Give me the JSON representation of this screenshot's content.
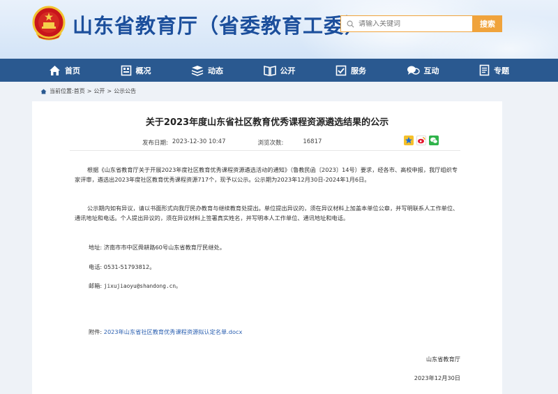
{
  "header": {
    "site_title": "山东省教育厅（省委教育工委）",
    "search_placeholder": "请输入关键词",
    "search_button": "搜索"
  },
  "nav": {
    "items": [
      {
        "label": "首页",
        "icon": "home-icon"
      },
      {
        "label": "概况",
        "icon": "overview-icon"
      },
      {
        "label": "动态",
        "icon": "news-icon"
      },
      {
        "label": "公开",
        "icon": "book-icon"
      },
      {
        "label": "服务",
        "icon": "service-icon"
      },
      {
        "label": "互动",
        "icon": "chat-icon"
      },
      {
        "label": "专题",
        "icon": "topic-icon"
      }
    ]
  },
  "breadcrumb": {
    "prefix": "当前位置:",
    "items": [
      "首页",
      "公开",
      "公示公告"
    ],
    "separator": ">"
  },
  "article": {
    "title": "关于2023年度山东省社区教育优秀课程资源遴选结果的公示",
    "publish_label": "发布日期:",
    "publish_date": "2023-12-30 10:47",
    "views_label": "浏览次数:",
    "views": "16817",
    "share_icons": [
      "qzone-icon",
      "weibo-icon",
      "wechat-icon"
    ],
    "paragraph1": "根据《山东省教育厅关于开展2023年度社区教育优秀课程资源遴选活动的通知》（鲁教民函〔2023〕14号）要求，经各市、高校申报，我厅组织专家评审，遴选出2023年度社区教育优秀课程资源717个，现予以公示。公示期为2023年12月30日-2024年1月6日。",
    "paragraph2": "公示期内如有异议，请以书面形式向我厅民办教育与继续教育处提出。单位提出异议的，须在异议材料上加盖本单位公章，并写明联系人工作单位、通讯地址和电话。个人提出异议的，须在异议材料上签署真实姓名，并写明本人工作单位、通讯地址和电话。",
    "address_label": "地址:",
    "address": "济南市市中区舜耕路60号山东省教育厅民继处。",
    "tel_label": "电话:",
    "tel": "0531-51793812。",
    "email_label": "邮箱:",
    "email": "jixujiaoyu@shandong.cn。",
    "attachment_label": "附件:",
    "attachment": "2023年山东省社区教育优秀课程资源拟认定名单.docx",
    "signature": "山东省教育厅",
    "sign_date": "2023年12月30日"
  },
  "colors": {
    "nav_bg": "#2a5990",
    "title_blue": "#1c4f9c",
    "search_orange": "#f0a33c",
    "link_blue": "#2a5fb0"
  }
}
